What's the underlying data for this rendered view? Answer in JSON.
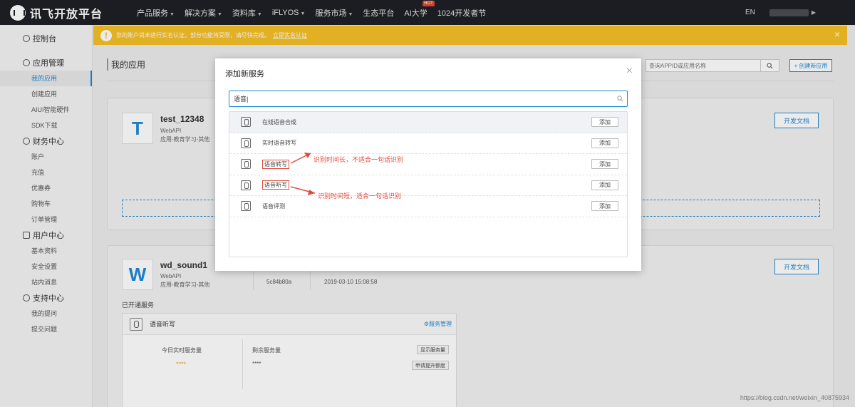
{
  "topnav": {
    "logo_text": "讯飞开放平台",
    "items": [
      {
        "label": "产品服务",
        "dropdown": true
      },
      {
        "label": "解决方案",
        "dropdown": true
      },
      {
        "label": "资料库",
        "dropdown": true
      },
      {
        "label": "iFLYOS",
        "dropdown": true
      },
      {
        "label": "服务市场",
        "dropdown": true
      },
      {
        "label": "生态平台",
        "dropdown": false
      },
      {
        "label": "AI大学",
        "dropdown": false,
        "badge": "HOT"
      },
      {
        "label": "1024开发者节",
        "dropdown": false
      }
    ],
    "lang": "EN"
  },
  "sidebar": {
    "console": "控制台",
    "sections": [
      {
        "title": "应用管理",
        "items": [
          "我的应用",
          "创建应用",
          "AIUI智能硬件",
          "SDK下载"
        ]
      },
      {
        "title": "财务中心",
        "items": [
          "账户",
          "充值",
          "优惠券",
          "购物车",
          "订单管理"
        ]
      },
      {
        "title": "用户中心",
        "items": [
          "基本资料",
          "安全设置",
          "站内消息"
        ]
      },
      {
        "title": "支持中心",
        "items": [
          "我的提问",
          "提交问题"
        ]
      }
    ],
    "active_item": "我的应用"
  },
  "notice": {
    "text": "您的账户尚未进行实名认证，部分功能将受限，请尽快完成。",
    "link": "立即实名认证",
    "close": "×"
  },
  "main": {
    "page_title": "我的应用",
    "search_placeholder": "查询APPID或应用名称",
    "create_button": "创建新应用",
    "apps": [
      {
        "avatar": "T",
        "name": "test_12348",
        "type": "WebAPI",
        "category": "应用-教育学习-其他",
        "dev_doc": "开发文档"
      },
      {
        "avatar": "W",
        "name": "wd_sound1",
        "type": "WebAPI",
        "category": "应用-教育学习-其他",
        "appid": "5c84b80a",
        "date": "2019-03-10 15:08:58",
        "dev_doc": "开发文档",
        "opened_label": "已开通服务",
        "service": {
          "name": "语音听写",
          "manage": "服务管理",
          "today_label": "今日实时服务量",
          "today_value": "****",
          "remain_label": "剩余服务量",
          "remain_value": "****",
          "show_btn": "显示服务量",
          "raise_btn": "申请提升额度"
        }
      }
    ]
  },
  "modal": {
    "title": "添加新服务",
    "close": "×",
    "search_value": "语音|",
    "services": [
      {
        "label": "在线语音合成",
        "add": "添加"
      },
      {
        "label": "实时语音转写",
        "add": "添加"
      },
      {
        "label": "语音转写",
        "add": "添加"
      },
      {
        "label": "语音听写",
        "add": "添加"
      },
      {
        "label": "语音评测",
        "add": "添加"
      }
    ],
    "annotations": [
      "识别时间长，不适合一句话识别",
      "识别时间短，适合一句话识别"
    ]
  },
  "watermark": "https://blog.csdn.net/weixin_40875934",
  "colors": {
    "accent": "#1f8ad4",
    "notice": "#f6bf26",
    "annotation": "#e04b3f",
    "nav_bg": "#1e2025"
  }
}
